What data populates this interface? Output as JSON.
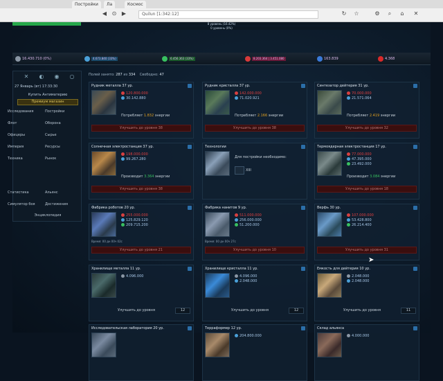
{
  "browser": {
    "tabs": [
      "Постройки",
      "Ла",
      "Космос"
    ],
    "url": "Quilun  [1:342:12]",
    "toolbar_icons": [
      "back-icon",
      "forward-icon",
      "reload-icon",
      "home-icon",
      "star-icon",
      "settings-icon",
      "close-icon"
    ]
  },
  "progress": [
    {
      "label": "8 уровень (16.42%)",
      "pct": 16.42
    },
    {
      "label": "0 уровень (0%)",
      "pct": 0
    }
  ],
  "resources": [
    {
      "name": "metal",
      "value": "16.430.710 (0%)",
      "color": "#8a96a4"
    },
    {
      "name": "crystal",
      "value": "4.673.840 (33%)",
      "color": "#4aa0d8"
    },
    {
      "name": "deuterium",
      "value": "6.456.363 (33%)",
      "color": "#38c060"
    },
    {
      "name": "energy",
      "value": "8.203.364  |  3.451.080",
      "color": "#d83a3a"
    },
    {
      "name": "dm",
      "value": "163.839",
      "color": "#3a7ad8"
    },
    {
      "name": "other",
      "value": "4.368",
      "color": "#d82a2a"
    }
  ],
  "left": {
    "icons": [
      "x-icon",
      "moon-icon",
      "eye-icon",
      "circle-icon"
    ],
    "date": "27 Январь (вт) 17:33:30",
    "buy": "Купить  Антиматерию",
    "premium": "Премиум магазин",
    "menu": [
      {
        "l": "Исследования",
        "r": "Постройки"
      },
      {
        "l": "Флот",
        "r": "Оборона"
      },
      {
        "l": "Офицеры",
        "r": "Сырье"
      },
      {
        "l": "Империя",
        "r": "Ресурсы"
      },
      {
        "l": "Техника",
        "r": "Рынок"
      },
      {
        "l": "Статистика",
        "r": "Альянс"
      },
      {
        "l": "Симулятор боя",
        "r": "Достижения"
      }
    ],
    "encyc": "Энциклопедия"
  },
  "main": {
    "used_label": "Полей занято:",
    "used": "287",
    "of": "из",
    "total": "334",
    "free_label": "Свободно:",
    "free": "47"
  },
  "cards": [
    {
      "title": "Рудник металла 37 ур.",
      "pic": "metal",
      "costs": [
        {
          "c": "red",
          "ic": "#d84040",
          "v": "120.800.000"
        },
        {
          "c": "blue",
          "ic": "#4aa0d8",
          "v": "30.142.880"
        }
      ],
      "energy_label": "Потребляет",
      "energy": "1.832",
      "energy_suffix": "энергии",
      "upgrade": "Улучшить до уровня 38",
      "ok": false
    },
    {
      "title": "Рудник кристалла 37 ур.",
      "pic": "crystal",
      "costs": [
        {
          "c": "red",
          "ic": "#d84040",
          "v": "142.000.000"
        },
        {
          "c": "blue",
          "ic": "#4aa0d8",
          "v": "71.020.921"
        }
      ],
      "energy_label": "Потребляет",
      "energy": "2.166",
      "energy_suffix": "энергии",
      "upgrade": "Улучшить до уровня 38",
      "ok": false
    },
    {
      "title": "Синтезатор дейтерия 31 ур.",
      "pic": "deut",
      "costs": [
        {
          "c": "red",
          "ic": "#d84040",
          "v": "70.000.000"
        },
        {
          "c": "blue",
          "ic": "#4aa0d8",
          "v": "21.571.064"
        }
      ],
      "energy_label": "Потребляет",
      "energy": "2.419",
      "energy_suffix": "энергии",
      "upgrade": "Улучшить до уровня 32",
      "ok": false
    },
    {
      "title": "Солнечная электростанция 37 ур.",
      "pic": "solar",
      "costs": [
        {
          "c": "red",
          "ic": "#d84040",
          "v": "198.000.000"
        },
        {
          "c": "blue",
          "ic": "#4aa0d8",
          "v": "99.267.280"
        }
      ],
      "energy_label": "Производит",
      "energy": "3.364",
      "energy_suffix": "энергии",
      "upgrade": "Улучшить до уровня 38",
      "ok": false
    },
    {
      "title": "Технологии",
      "pic": "fusion",
      "need": "Для постройки необходимо:",
      "xlab": "XIII",
      "upgrade": "",
      "ok": true,
      "locked": true
    },
    {
      "title": "Термоядерная электростанция 17 ур.",
      "pic": "thermo",
      "costs": [
        {
          "c": "red",
          "ic": "#d84040",
          "v": "77.000.000"
        },
        {
          "c": "blue",
          "ic": "#4aa0d8",
          "v": "47.395.000"
        },
        {
          "c": "blue",
          "ic": "#38c060",
          "v": "23.492.000"
        }
      ],
      "energy_label": "Производит",
      "energy": "3.084",
      "energy_suffix": "энергии",
      "upgrade": "Улучшить до уровня 18",
      "ok": false
    },
    {
      "title": "Фабрика роботов 20 ур.",
      "pic": "robot",
      "costs": [
        {
          "c": "red",
          "ic": "#d84040",
          "v": "255.000.000"
        },
        {
          "c": "blue",
          "ic": "#4aa0d8",
          "v": "125.829.120"
        },
        {
          "c": "blue",
          "ic": "#38c060",
          "v": "209.715.200"
        }
      ],
      "time": "Время: 00 дн 00ч 02с",
      "upgrade": "Улучшить до уровня 21",
      "ok": false
    },
    {
      "title": "Фабрика нанитов 9 ур.",
      "pic": "nanite",
      "costs": [
        {
          "c": "red",
          "ic": "#d84040",
          "v": "511.000.000"
        },
        {
          "c": "blue",
          "ic": "#4aa0d8",
          "v": "256.000.000"
        },
        {
          "c": "blue",
          "ic": "#38c060",
          "v": "51.200.000"
        }
      ],
      "time": "Время: 00 дн 00ч 27с",
      "upgrade": "Улучшить до уровня 10",
      "ok": false
    },
    {
      "title": "Верфь 30 ур.",
      "pic": "shipyard",
      "costs": [
        {
          "c": "red",
          "ic": "#d84040",
          "v": "107.000.000"
        },
        {
          "c": "blue",
          "ic": "#4aa0d8",
          "v": "53.428.800"
        },
        {
          "c": "blue",
          "ic": "#38c060",
          "v": "26.214.400"
        }
      ],
      "upgrade": "Улучшить до уровня 31",
      "ok": false
    },
    {
      "title": "Хранилище металла 11 ур.",
      "pic": "metalstore",
      "costs": [
        {
          "c": "blue",
          "ic": "#8a96a4",
          "v": "4.096.000"
        }
      ],
      "upgrade": "Улучшить до уровня",
      "lvl": "12",
      "ok": true
    },
    {
      "title": "Хранилище кристалла 11 ур.",
      "pic": "crystalstore",
      "costs": [
        {
          "c": "blue",
          "ic": "#8a96a4",
          "v": "4.096.000"
        },
        {
          "c": "blue",
          "ic": "#4aa0d8",
          "v": "2.048.000"
        }
      ],
      "upgrade": "Улучшить до уровня",
      "lvl": "12",
      "ok": true
    },
    {
      "title": "Ёмкость для дейтерия 10 ур.",
      "pic": "deutstore",
      "costs": [
        {
          "c": "blue",
          "ic": "#8a96a4",
          "v": "2.048.000"
        },
        {
          "c": "blue",
          "ic": "#4aa0d8",
          "v": "2.048.000"
        }
      ],
      "upgrade": "Улучшить до уровня",
      "lvl": "11",
      "ok": true
    },
    {
      "title": "Исследовательская лаборатория 20 ур.",
      "pic": "lab",
      "costs": [],
      "upgrade": "",
      "ok": true
    },
    {
      "title": "Терраформер 12 ур.",
      "pic": "terra",
      "costs": [
        {
          "c": "blue",
          "ic": "#4aa0d8",
          "v": "204.800.000"
        }
      ],
      "upgrade": "",
      "ok": true
    },
    {
      "title": "Склад альянса",
      "pic": "alliance",
      "costs": [
        {
          "c": "blue",
          "ic": "#8a96a4",
          "v": "4.000.000"
        }
      ],
      "upgrade": "",
      "ok": true
    }
  ]
}
